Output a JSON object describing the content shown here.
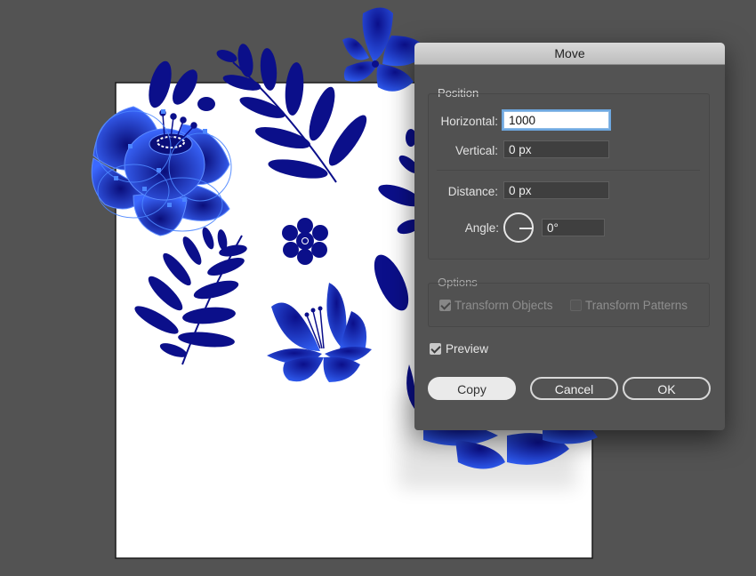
{
  "dialog": {
    "title": "Move",
    "position": {
      "group_label": "Position",
      "horizontal_label": "Horizontal:",
      "horizontal_value": "1000",
      "vertical_label": "Vertical:",
      "vertical_value": "0 px",
      "distance_label": "Distance:",
      "distance_value": "0 px",
      "angle_label": "Angle:",
      "angle_value": "0°"
    },
    "options": {
      "group_label": "Options",
      "transform_objects_label": "Transform Objects",
      "transform_objects_checked": true,
      "transform_patterns_label": "Transform Patterns",
      "transform_patterns_checked": false
    },
    "preview_label": "Preview",
    "preview_checked": true,
    "buttons": {
      "copy": "Copy",
      "cancel": "Cancel",
      "ok": "OK"
    }
  },
  "colors": {
    "workspace": "#535353",
    "artboard": "#ffffff",
    "navy": "#0b0f8a",
    "gradient_light": "#3a6cff",
    "selection": "#4c86ff"
  }
}
